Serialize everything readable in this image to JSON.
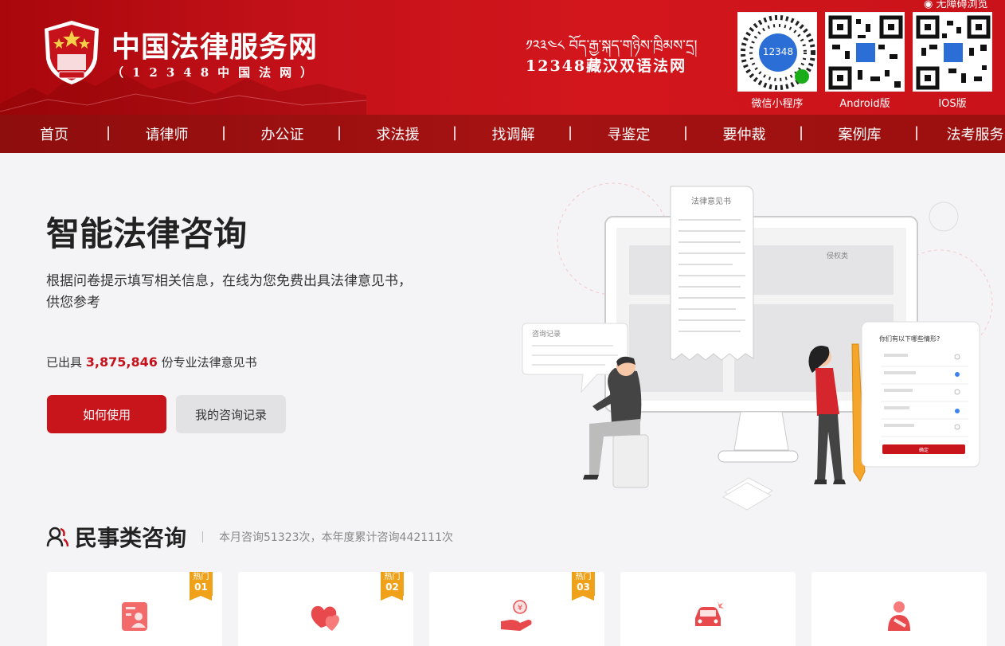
{
  "header": {
    "site_title": "中国法律服务网",
    "site_subtitle": "（12348中国法网）",
    "tibetan": "༡༢༣༤༨ བོད་རྒྱ་སྐད་གཉིས་ཁྲིམས་དྲ།",
    "bilingual_site": "12348藏汉双语法网",
    "barrier_free": "无障碍浏览",
    "qr_codes": [
      {
        "label": "微信小程序"
      },
      {
        "label": "Android版"
      },
      {
        "label": "IOS版"
      }
    ]
  },
  "nav": {
    "items": [
      "首页",
      "请律师",
      "办公证",
      "求法援",
      "找调解",
      "寻鉴定",
      "要仲裁",
      "案例库",
      "法考服务"
    ]
  },
  "hero": {
    "title": "智能法律咨询",
    "description": "根据问卷提示填写相关信息，在线为您免费出具法律意见书，供您参考",
    "issued_prefix": "已出具",
    "issued_count": "3,875,846",
    "issued_suffix": "份专业法律意见书",
    "primary_button": "如何使用",
    "secondary_button": "我的咨询记录"
  },
  "illustration": {
    "doc_title": "法律意见书",
    "record_title": "咨询记录",
    "rights_label": "侵权类",
    "question": "你们有以下哪些情形?",
    "submit": "确定"
  },
  "section": {
    "title": "民事类咨询",
    "stat": "本月咨询51323次，本年度累计咨询442111次"
  },
  "cards": [
    {
      "hot_label": "热门",
      "hot_rank": "01",
      "icon": "id-card-icon"
    },
    {
      "hot_label": "热门",
      "hot_rank": "02",
      "icon": "hearts-icon"
    },
    {
      "hot_label": "热门",
      "hot_rank": "03",
      "icon": "money-hand-icon"
    },
    {
      "icon": "car-accident-icon"
    },
    {
      "icon": "injured-person-icon"
    }
  ],
  "colors": {
    "brand_red": "#c8151c",
    "nav_red": "#9c1010",
    "hot_orange": "#f0a11a"
  }
}
